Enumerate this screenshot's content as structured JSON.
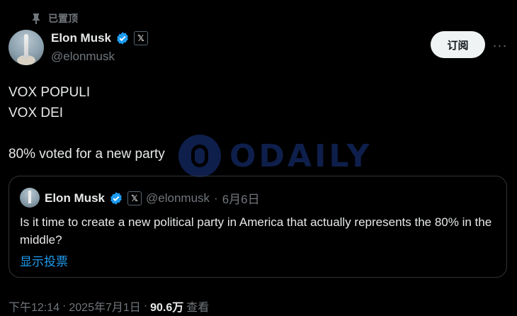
{
  "pinned_label": "已置顶",
  "author": {
    "name": "Elon Musk",
    "handle": "@elonmusk",
    "affiliate_badge": "𝕏"
  },
  "subscribe_label": "订阅",
  "more_label": "···",
  "tweet_lines": [
    "VOX POPULI",
    "VOX DEI",
    "",
    "80% voted for a new party"
  ],
  "watermark_text": "ODAILY",
  "quote": {
    "name": "Elon Musk",
    "affiliate_badge": "𝕏",
    "handle": "@elonmusk",
    "separator": "·",
    "date": "6月6日",
    "body": "Is it time to create a new political party in America that actually represents the 80% in the middle?",
    "poll_link": "显示投票"
  },
  "meta": {
    "time": "下午12:14",
    "sep1": "·",
    "date": "2025年7月1日",
    "sep2": "·",
    "views_count": "90.6万",
    "views_label": "查看"
  },
  "colors": {
    "accent": "#1d9bf0",
    "muted": "#71767b",
    "verified": "#1d9bf0"
  }
}
